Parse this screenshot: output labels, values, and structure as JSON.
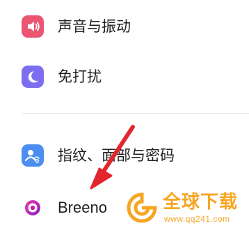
{
  "settings": {
    "items": [
      {
        "label": "声音与振动",
        "icon": "speaker-icon",
        "color": "#ea5572"
      },
      {
        "label": "免打扰",
        "icon": "moon-icon",
        "color": "#7d6ef0"
      },
      {
        "label": "指纹、面部与密码",
        "icon": "face-fingerprint-icon",
        "color": "#4a8ff0"
      },
      {
        "label": "Breeno",
        "icon": "breeno-ring-icon",
        "color": "#c21ea8"
      }
    ]
  },
  "annotation": {
    "arrow_color": "#e3262e"
  },
  "watermark": {
    "title": "全球下载",
    "url": "www.qq241.com",
    "color": "#f6a623"
  }
}
